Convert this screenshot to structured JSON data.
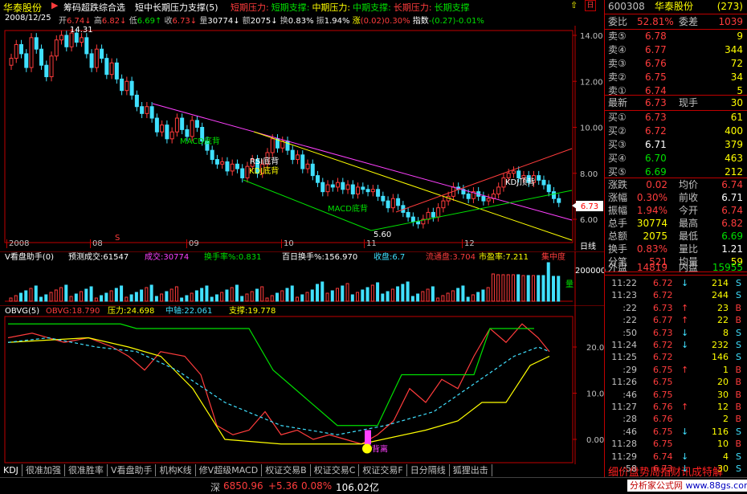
{
  "topbar": {
    "stock_name": "华泰股份",
    "formula1": "筹码超跌综合选",
    "formula2": "短中长期压力支撑(5)",
    "legend": [
      {
        "label": "短期压力",
        "color": "#ff3c3c"
      },
      {
        "label": "短期支撑",
        "color": "#00e000"
      },
      {
        "label": "中期压力",
        "color": "#ffff00"
      },
      {
        "label": "中期支撑",
        "color": "#00e000"
      },
      {
        "label": "长期压力",
        "color": "#ff3c3c"
      },
      {
        "label": "长期支撑",
        "color": "#00e000"
      }
    ]
  },
  "statbar": {
    "date": "2008/12/25",
    "open_label": "开",
    "open": "6.74",
    "high_label": "高",
    "high": "6.82",
    "low_label": "低",
    "low": "6.69",
    "close_label": "收",
    "close": "6.73",
    "vol_label": "量",
    "vol": "30774",
    "amt_label": "额",
    "amt": "2075",
    "turn_label": "换",
    "turn": "0.83%",
    "amp_label": "振",
    "amp": "1.94%",
    "chg_label": "涨",
    "chg": "(0.02)0.30%",
    "idx_label": "指数",
    "idx": "-(0.27)-0.01%"
  },
  "main_chart": {
    "y_ticks": [
      "14.00",
      "12.00",
      "10.00",
      "8.00",
      "6.00"
    ],
    "high_label": "14.31",
    "low_label": "5.60",
    "current_price": "6.73",
    "date_ticks": [
      "2008",
      "08",
      "09",
      "10",
      "11",
      "12"
    ],
    "log_label": "日线",
    "annotations": [
      {
        "text": "MACD底背",
        "color": "#00e000"
      },
      {
        "text": "RSI底背",
        "color": "#ffffff"
      },
      {
        "text": "KDJ底背",
        "color": "#ffff00"
      },
      {
        "text": "MACD底背",
        "color": "#00e000"
      },
      {
        "text": "KDJ顶背",
        "color": "#ffffff"
      }
    ]
  },
  "vol": {
    "name": "V看盘助手(0)",
    "predict": "预测成交:61547",
    "vol": "成交:30774",
    "turn": "换手率%:0.831",
    "hundred": "百日换手%:156.970",
    "close": "收盘:6.7",
    "float": "流通盘:3.704",
    "pe": "市盈率:7.211",
    "conc": "集中度",
    "y_tick": "200000",
    "side_label": "量"
  },
  "obv": {
    "name": "OBVG(5)",
    "obvg": "OBVG:18.790",
    "pressure": "压力:24.698",
    "mid": "中轴:22.061",
    "support": "支撑:19.778",
    "y_ticks": [
      "20.00",
      "10.00",
      "0.00"
    ],
    "annotation": "背离"
  },
  "tabs": [
    "KDJ",
    "很准加强",
    "很准胜率",
    "V看盘助手",
    "机构K线",
    "修V超级MACD",
    "权证交易B",
    "权证交易C",
    "权证交易F",
    "日分隔线",
    "狐狸出击"
  ],
  "statusbar": {
    "market": "深",
    "index": "6850.96",
    "change": "+5.36",
    "pct": "0.08%",
    "amount": "106.02亿",
    "brand_text": "细价盘势周指财讯成特解",
    "site": "分析家公式网",
    "url": "www.88gs.com"
  },
  "right": {
    "code": "600308",
    "name": "华泰股份",
    "num": "(273)",
    "weibi_label": "委比",
    "weibi": "52.81%",
    "weicha_label": "委差",
    "weicha": "1039",
    "asks": [
      {
        "label": "卖⑤",
        "price": "6.78",
        "vol": "9"
      },
      {
        "label": "卖④",
        "price": "6.77",
        "vol": "344"
      },
      {
        "label": "卖③",
        "price": "6.76",
        "vol": "72"
      },
      {
        "label": "卖②",
        "price": "6.75",
        "vol": "34"
      },
      {
        "label": "卖①",
        "price": "6.74",
        "vol": "5"
      }
    ],
    "latest_label": "最新",
    "latest": "6.73",
    "now_label": "现手",
    "now": "30",
    "bids": [
      {
        "label": "买①",
        "price": "6.73",
        "vol": "61"
      },
      {
        "label": "买②",
        "price": "6.72",
        "vol": "400"
      },
      {
        "label": "买③",
        "price": "6.71",
        "vol": "379"
      },
      {
        "label": "买④",
        "price": "6.70",
        "vol": "463"
      },
      {
        "label": "买⑤",
        "price": "6.69",
        "vol": "212"
      }
    ],
    "stats": [
      {
        "l1": "涨跌",
        "v1": "0.02",
        "l2": "均价",
        "v2": "6.74"
      },
      {
        "l1": "涨幅",
        "v1": "0.30%",
        "l2": "前收",
        "v2": "6.71"
      },
      {
        "l1": "振幅",
        "v1": "1.94%",
        "l2": "今开",
        "v2": "6.74"
      },
      {
        "l1": "总手",
        "v1": "30774",
        "l2": "最高",
        "v2": "6.82"
      },
      {
        "l1": "总额",
        "v1": "2075",
        "l2": "最低",
        "v2": "6.69"
      },
      {
        "l1": "换手",
        "v1": "0.83%",
        "l2": "量比",
        "v2": "1.21"
      },
      {
        "l1": "分笔",
        "v1": "521",
        "l2": "均量",
        "v2": "59"
      }
    ],
    "outer_label": "外盘",
    "outer": "14819",
    "inner_label": "内盘",
    "inner": "15955",
    "ticks": [
      {
        "t": "11:22",
        "p": "6.72",
        "a": "↓",
        "v": "214",
        "s": "S"
      },
      {
        "t": "11:23",
        "p": "6.72",
        "a": "",
        "v": "244",
        "s": "S"
      },
      {
        "t": ":22",
        "p": "6.73",
        "a": "↑",
        "v": "23",
        "s": "B"
      },
      {
        "t": ":22",
        "p": "6.77",
        "a": "↑",
        "v": "22",
        "s": "B"
      },
      {
        "t": ":50",
        "p": "6.73",
        "a": "↓",
        "v": "8",
        "s": "S"
      },
      {
        "t": "11:24",
        "p": "6.72",
        "a": "↓",
        "v": "232",
        "s": "S"
      },
      {
        "t": "11:25",
        "p": "6.72",
        "a": "",
        "v": "146",
        "s": "S"
      },
      {
        "t": ":29",
        "p": "6.75",
        "a": "↑",
        "v": "1",
        "s": "B"
      },
      {
        "t": "11:26",
        "p": "6.75",
        "a": "",
        "v": "20",
        "s": "B"
      },
      {
        "t": ":46",
        "p": "6.75",
        "a": "",
        "v": "30",
        "s": "B"
      },
      {
        "t": "11:27",
        "p": "6.76",
        "a": "↑",
        "v": "12",
        "s": "B"
      },
      {
        "t": ":28",
        "p": "6.76",
        "a": "",
        "v": "2",
        "s": "B"
      },
      {
        "t": ":46",
        "p": "6.75",
        "a": "↓",
        "v": "116",
        "s": "S"
      },
      {
        "t": "11:28",
        "p": "6.75",
        "a": "",
        "v": "10",
        "s": "B"
      },
      {
        "t": "11:29",
        "p": "6.74",
        "a": "↓",
        "v": "4",
        "s": "S"
      },
      {
        "t": ":58",
        "p": "6.73",
        "a": "↓",
        "v": "30",
        "s": "S"
      }
    ]
  }
}
